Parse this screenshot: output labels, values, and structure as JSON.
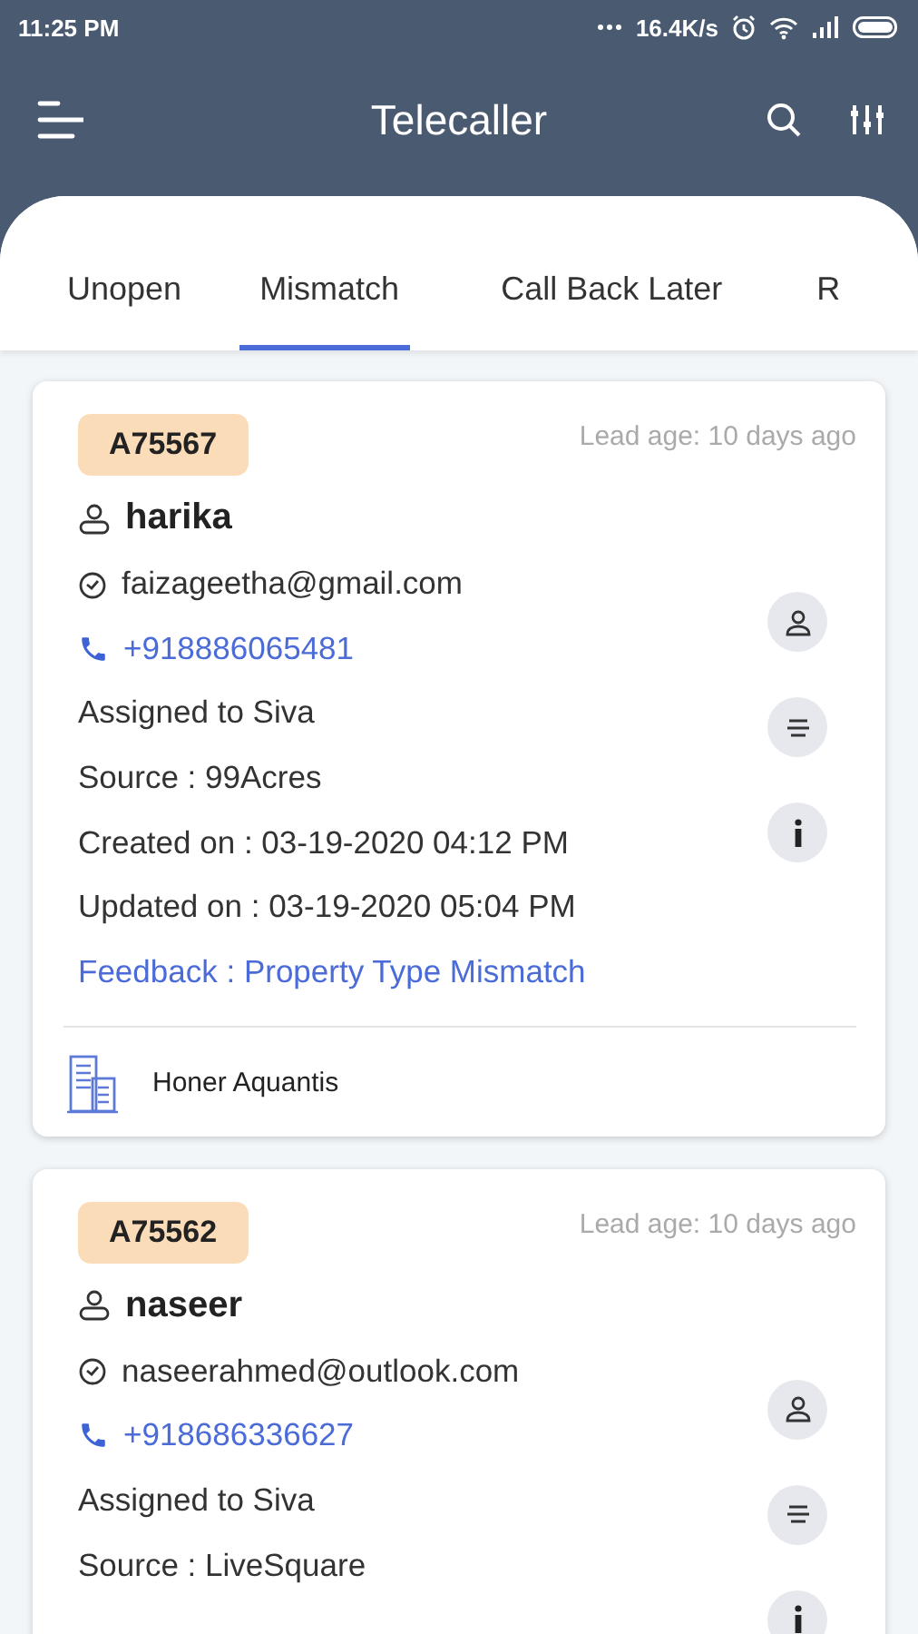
{
  "status_bar": {
    "time": "11:25 PM",
    "speed": "16.4K/s"
  },
  "app_bar": {
    "title": "Telecaller"
  },
  "tabs": [
    {
      "label": "Unopen",
      "selected": false
    },
    {
      "label": "Mismatch",
      "selected": true
    },
    {
      "label": "Call Back Later",
      "selected": false
    },
    {
      "label": "R",
      "selected": false
    }
  ],
  "leads": [
    {
      "id": "A75567",
      "lead_age": "Lead age: 10 days ago",
      "name": "harika",
      "email": "faizageetha@gmail.com",
      "phone": "+918886065481",
      "details": [
        {
          "kind": "plain",
          "text": "Assigned to Siva"
        },
        {
          "kind": "plain",
          "text": "Source : 99Acres"
        },
        {
          "kind": "plain",
          "text": "Created on : 03-19-2020 04:12 PM"
        },
        {
          "kind": "plain",
          "text": "Updated on : 03-19-2020 05:04 PM"
        },
        {
          "kind": "feedback",
          "text": "Feedback : Property Type Mismatch"
        }
      ],
      "project": "Honer Aquantis",
      "actions": [
        {
          "kind": "person"
        },
        {
          "kind": "list"
        },
        {
          "kind": "info"
        }
      ]
    },
    {
      "id": "A75562",
      "lead_age": "Lead age: 10 days ago",
      "name": "naseer",
      "email": "naseerahmed@outlook.com",
      "phone": "+918686336627",
      "details": [
        {
          "kind": "plain",
          "text": "Assigned to Siva"
        },
        {
          "kind": "plain",
          "text": "Source : LiveSquare"
        }
      ],
      "actions": [
        {
          "kind": "person"
        },
        {
          "kind": "list"
        },
        {
          "kind": "info"
        }
      ]
    }
  ]
}
